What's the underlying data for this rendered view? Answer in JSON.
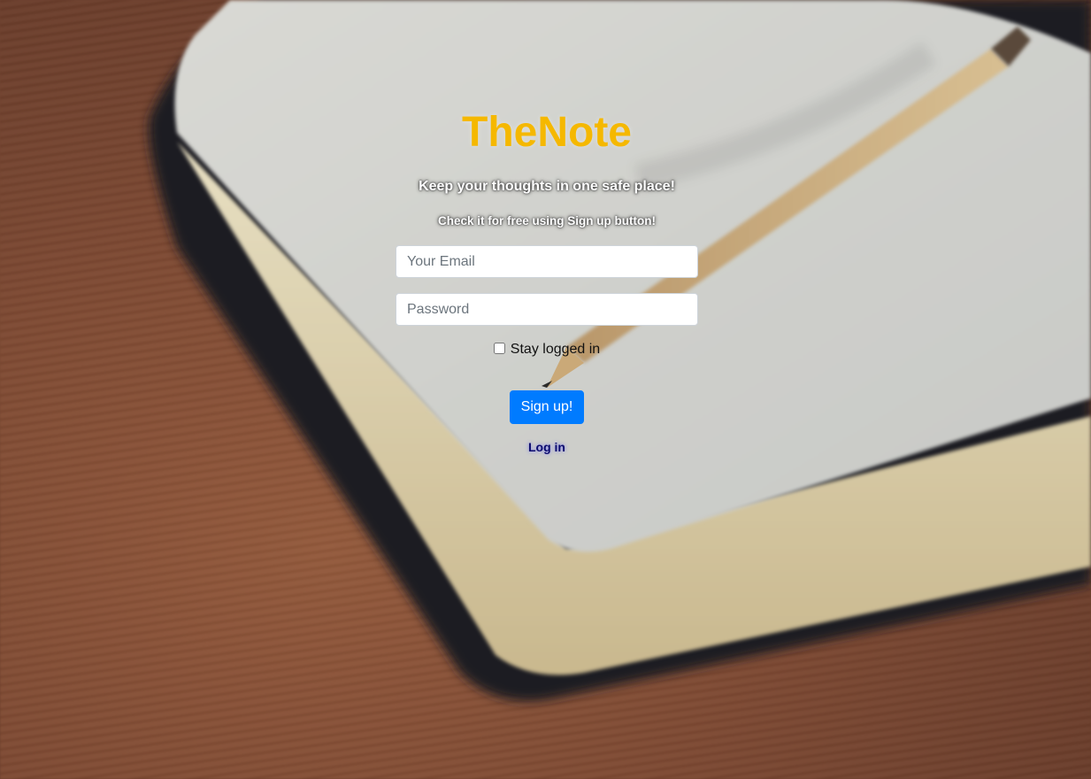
{
  "brand": {
    "title": "TheNote",
    "title_color": "#f5b800"
  },
  "hero": {
    "tagline": "Keep your thoughts in one safe place!",
    "subtagline": "Check it for free using Sign up button!"
  },
  "form": {
    "email_placeholder": "Your Email",
    "email_value": "",
    "password_placeholder": "Password",
    "password_value": "",
    "remember_label": "Stay logged in",
    "remember_checked": false,
    "signup_label": "Sign up!",
    "login_label": "Log in"
  },
  "colors": {
    "primary_button": "#007bff",
    "login_link": "#0c0c6e"
  },
  "background": {
    "description_icon": "notebook-with-pencil-photo"
  }
}
